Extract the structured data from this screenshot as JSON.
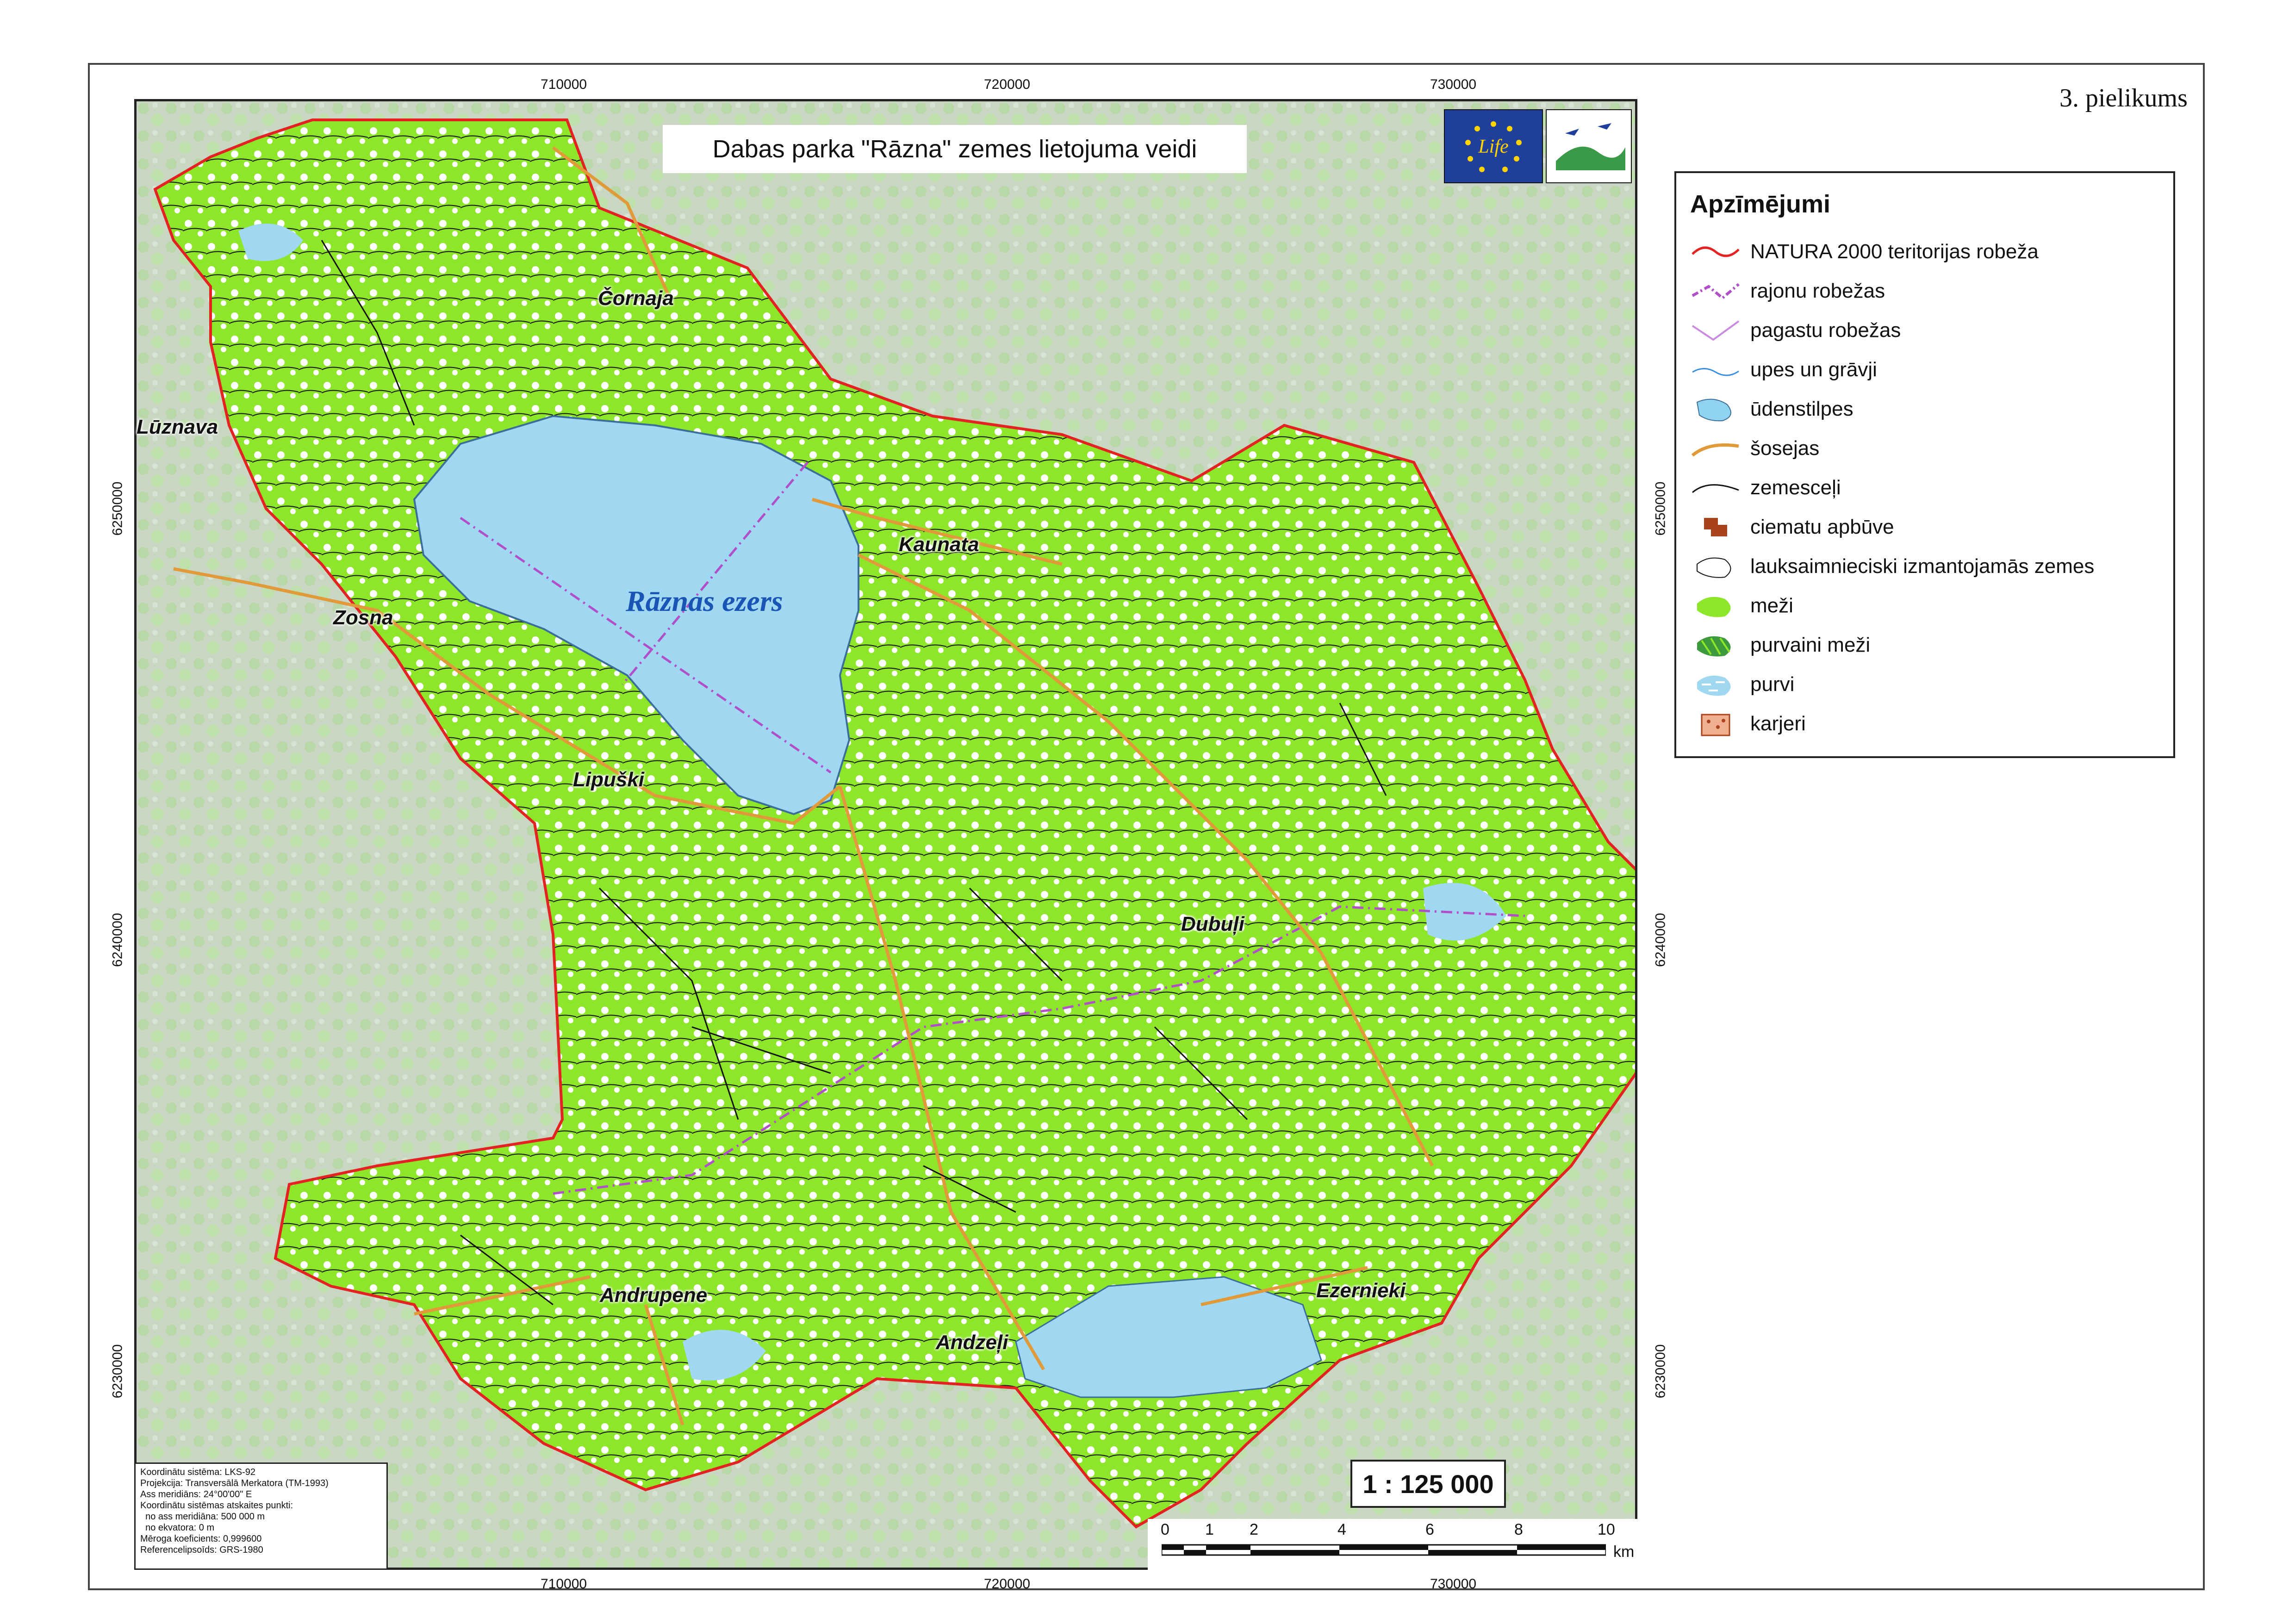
{
  "appendix_label": "3. pielikums",
  "title": "Dabas parka \"Rāzna\"  zemes lietojuma veidi",
  "grid": {
    "x_top": [
      "710000",
      "720000",
      "730000"
    ],
    "x_bottom": [
      "710000",
      "720000",
      "730000"
    ],
    "y_left": [
      "6250000",
      "6240000",
      "6230000"
    ],
    "y_right": [
      "6250000",
      "6240000",
      "6230000"
    ]
  },
  "places": [
    {
      "id": "luznava",
      "name": "Lūznava"
    },
    {
      "id": "cornaja",
      "name": "Čornaja"
    },
    {
      "id": "kaunata",
      "name": "Kaunata"
    },
    {
      "id": "zosna",
      "name": "Zosna"
    },
    {
      "id": "lipuski",
      "name": "Lipuški"
    },
    {
      "id": "dubuli",
      "name": "Dubuļi"
    },
    {
      "id": "andrupene",
      "name": "Andrupene"
    },
    {
      "id": "ezernieki",
      "name": "Ezernieki"
    },
    {
      "id": "andzeli",
      "name": "Andzeļi"
    }
  ],
  "lake_label": "Rāznas ezers",
  "legend": {
    "title": "Apzīmējumi",
    "items": [
      {
        "label": "NATURA 2000 teritorijas robeža",
        "icon": "red-wavy-line",
        "color": "#e32222"
      },
      {
        "label": "rajonu robežas",
        "icon": "purple-dashdot-line",
        "color": "#b04fc8"
      },
      {
        "label": "pagastu robežas",
        "icon": "pink-line",
        "color": "#c98adf"
      },
      {
        "label": "upes un grāvji",
        "icon": "blue-thin-line",
        "color": "#3a8ee0"
      },
      {
        "label": "ūdenstilpes",
        "icon": "water-patch",
        "color": "#8fd3f0"
      },
      {
        "label": "šosejas",
        "icon": "orange-road",
        "color": "#e09a3a"
      },
      {
        "label": "zemesceļi",
        "icon": "black-line",
        "color": "#111111"
      },
      {
        "label": "ciematu apbūve",
        "icon": "brown-block",
        "color": "#a8431d"
      },
      {
        "label": "lauksaimnieciski izmantojamās zemes",
        "icon": "white-patch",
        "color": "#ffffff"
      },
      {
        "label": "meži",
        "icon": "green-patch",
        "color": "#8ee62a"
      },
      {
        "label": "purvaini meži",
        "icon": "hatched-green",
        "color": "#3c9a3c"
      },
      {
        "label": "purvi",
        "icon": "marsh",
        "color": "#9fd8f0"
      },
      {
        "label": "karjeri",
        "icon": "quarry",
        "color": "#f0b090"
      }
    ]
  },
  "projection_info": [
    "Koordinātu sistēma: LKS-92",
    "Projekcija: Transversālā Merkatora (TM-1993)",
    "Ass meridiāns: 24°00'00\" E",
    "Koordinātu sistēmas atskaites punkti:",
    "  no ass meridiāna: 500 000 m",
    "  no ekvatora: 0 m",
    "Mēroga koeficients: 0,999600",
    "Referencelipsoīds: GRS-1980"
  ],
  "scale_text": "1 : 125 000",
  "scalebar": {
    "ticks": [
      "0",
      "1",
      "2",
      "4",
      "6",
      "8",
      "10"
    ],
    "unit": "km"
  },
  "colors": {
    "boundary": "#e32222",
    "water": "#9fd8f0",
    "forest": "#8ee62a",
    "background_terrain": "#c8d2c8"
  }
}
